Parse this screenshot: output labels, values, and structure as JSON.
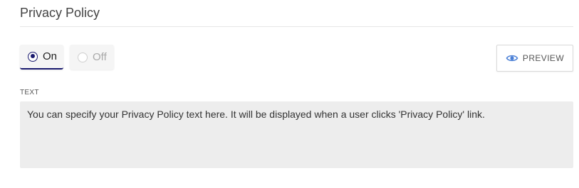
{
  "section": {
    "title": "Privacy Policy"
  },
  "toggle": {
    "on_label": "On",
    "off_label": "Off",
    "selected": "On"
  },
  "preview": {
    "label": "PREVIEW",
    "icon": "eye-icon"
  },
  "text_field": {
    "label": "TEXT",
    "value": "You can specify your Privacy Policy text here. It will be displayed when a user clicks 'Privacy Policy' link."
  },
  "colors": {
    "accent": "#1a1a6e",
    "preview_icon": "#4a7fd6",
    "textarea_bg": "#ededed"
  }
}
